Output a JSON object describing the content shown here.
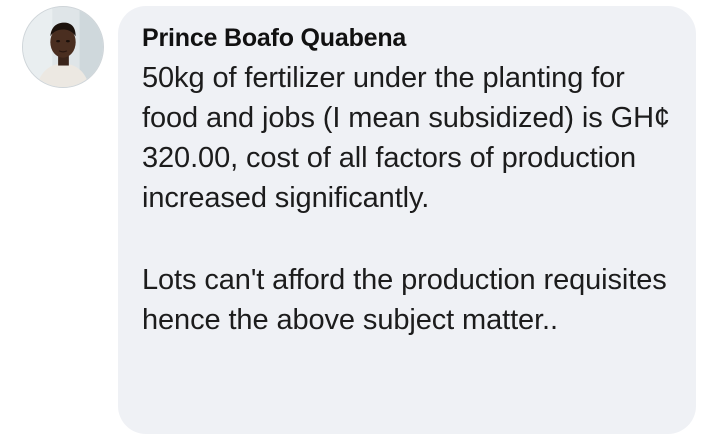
{
  "comment": {
    "author": "Prince Boafo Quabena",
    "paragraphs": [
      "50kg of fertilizer under the planting for food and jobs (I mean subsidized) is GH¢ 320.00, cost of all factors of production increased significantly.",
      "Lots can't afford the production requisites hence the above subject matter.."
    ]
  },
  "avatar": {
    "icon": "profile-photo"
  },
  "colors": {
    "bubble_background": "#eff1f5",
    "text": "#1c1c1c",
    "author": "#111111"
  }
}
